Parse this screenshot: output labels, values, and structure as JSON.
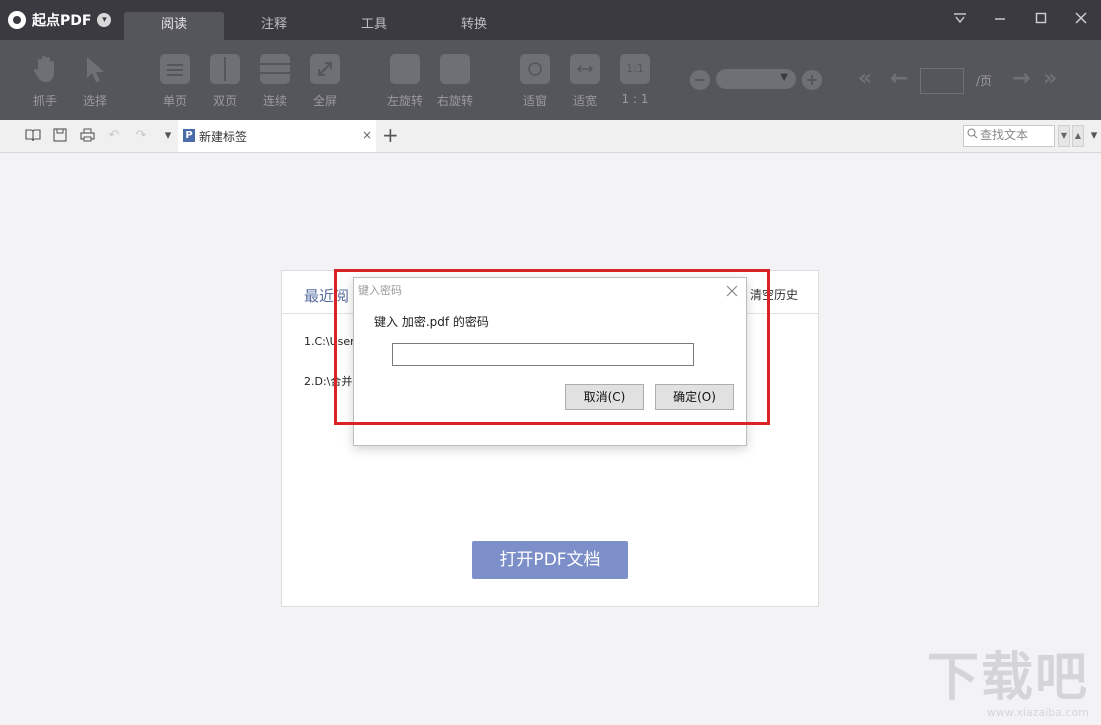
{
  "app": {
    "name": "起点PDF"
  },
  "menu_tabs": [
    {
      "label": "阅读",
      "active": true
    },
    {
      "label": "注释",
      "active": false
    },
    {
      "label": "工具",
      "active": false
    },
    {
      "label": "转换",
      "active": false
    }
  ],
  "toolbar": {
    "hand": "抓手",
    "select": "选择",
    "single_page": "单页",
    "double_page": "双页",
    "continuous": "连续",
    "fullscreen": "全屏",
    "rotate_left": "左旋转",
    "rotate_right": "右旋转",
    "fit_window": "适窗",
    "fit_width": "适宽",
    "actual_size": "1 : 1",
    "actual_size_icon": "1:1",
    "page_value": "",
    "page_unit": "/页"
  },
  "tab_strip": {
    "tab_label": "新建标签",
    "tab_close": "×",
    "add_tab": "+",
    "search_placeholder": "查找文本"
  },
  "recent": {
    "title": "最近阅",
    "clear_history": "清空历史",
    "items": [
      "1.C:\\User",
      "2.D:\\合并"
    ],
    "open_button": "打开PDF文档"
  },
  "dialog": {
    "title": "键入密码",
    "prompt": "键入 加密.pdf 的密码",
    "input_value": "",
    "cancel": "取消(C)",
    "ok": "确定(O)"
  },
  "watermark": {
    "main": "下载吧",
    "sub": "www.xiazaiba.com"
  },
  "colors": {
    "titlebar": "#3a3a40",
    "toolbar": "#55555c",
    "highlight": "#d82424",
    "open_button": "#7d8fc9"
  }
}
